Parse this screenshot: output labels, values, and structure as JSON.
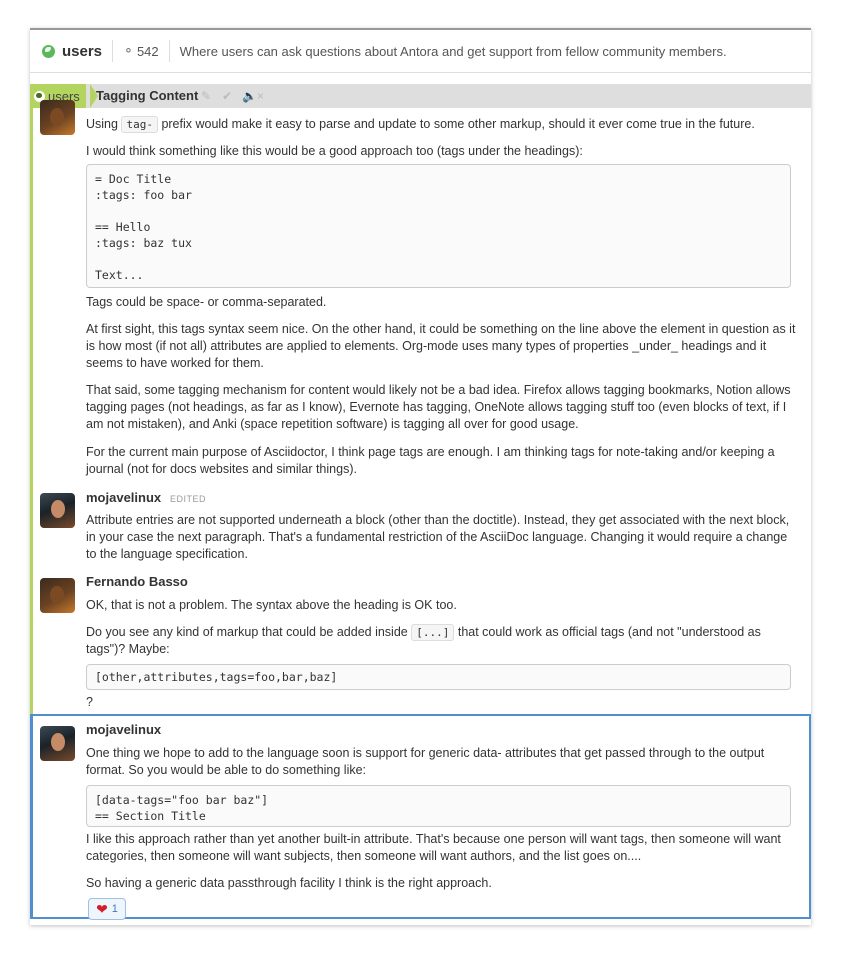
{
  "header": {
    "stream": "users",
    "subscribers": "542",
    "description": "Where users can ask questions about Antora and get support from fellow community members."
  },
  "recipient": {
    "stream": "users",
    "topic": "Tagging Content"
  },
  "messages": {
    "m1_p1_a": "Using",
    "m1_p1_code": "tag-",
    "m1_p1_b": "prefix would make it easy to parse and update to some other markup, should it ever come true in the future.",
    "m1_p2": "I would think something like this would be a good approach too (tags under the headings):",
    "m1_code": "= Doc Title\n:tags: foo bar\n\n== Hello\n:tags: baz tux\n\nText...",
    "m1_p3": "Tags could be space- or comma-separated.",
    "m1_p4": "At first sight, this tags syntax seem nice. On the other hand, it could be something on the line above the element in question as it is how most (if not all) attributes are applied to elements. Org-mode uses many types of properties _under_ headings and it seems to have worked for them.",
    "m1_p5": "That said, some tagging mechanism for content would likely not be a bad idea. Firefox allows tagging bookmarks, Notion allows tagging pages (not headings, as far as I know), Evernote has tagging, OneNote allows tagging stuff too (even blocks of text, if I am not mistaken), and Anki (space repetition software) is tagging all over for good usage.",
    "m1_p6": "For the current main purpose of Asciidoctor, I think page tags are enough. I am thinking tags for note-taking and/or keeping a journal (not for docs websites and similar things).",
    "m2_sender": "mojavelinux",
    "m2_edited": "EDITED",
    "m2_p1": "Attribute entries are not supported underneath a block (other than the doctitle). Instead, they get associated with the next block, in your case the next paragraph. That's a fundamental restriction of the AsciiDoc language. Changing it would require a change to the language specification.",
    "m3_sender": "Fernando Basso",
    "m3_p1": "OK, that is not a problem. The syntax above the heading is OK too.",
    "m3_p2_a": "Do you see any kind of markup that could be added inside",
    "m3_p2_code": "[...]",
    "m3_p2_b": "that could work as official tags (and not \"understood as tags\")? Maybe:",
    "m3_code": "[other,attributes,tags=foo,bar,baz]",
    "m3_p3": "?",
    "m4_sender": "mojavelinux",
    "m4_p1": "One thing we hope to add to the language soon is support for generic data- attributes that get passed through to the output format. So you would be able to do something like:",
    "m4_code": "[data-tags=\"foo bar baz\"]\n== Section Title",
    "m4_p2": "I like this approach rather than yet another built-in attribute. That's because one person will want tags, then someone will want categories, then someone will want subjects, then someone will want authors, and the list goes on....",
    "m4_p3": "So having a generic data passthrough facility I think is the right approach.",
    "m4_reaction_count": "1"
  },
  "colors": {
    "stream": "#b3d55f",
    "selected": "#4f8fd0"
  }
}
